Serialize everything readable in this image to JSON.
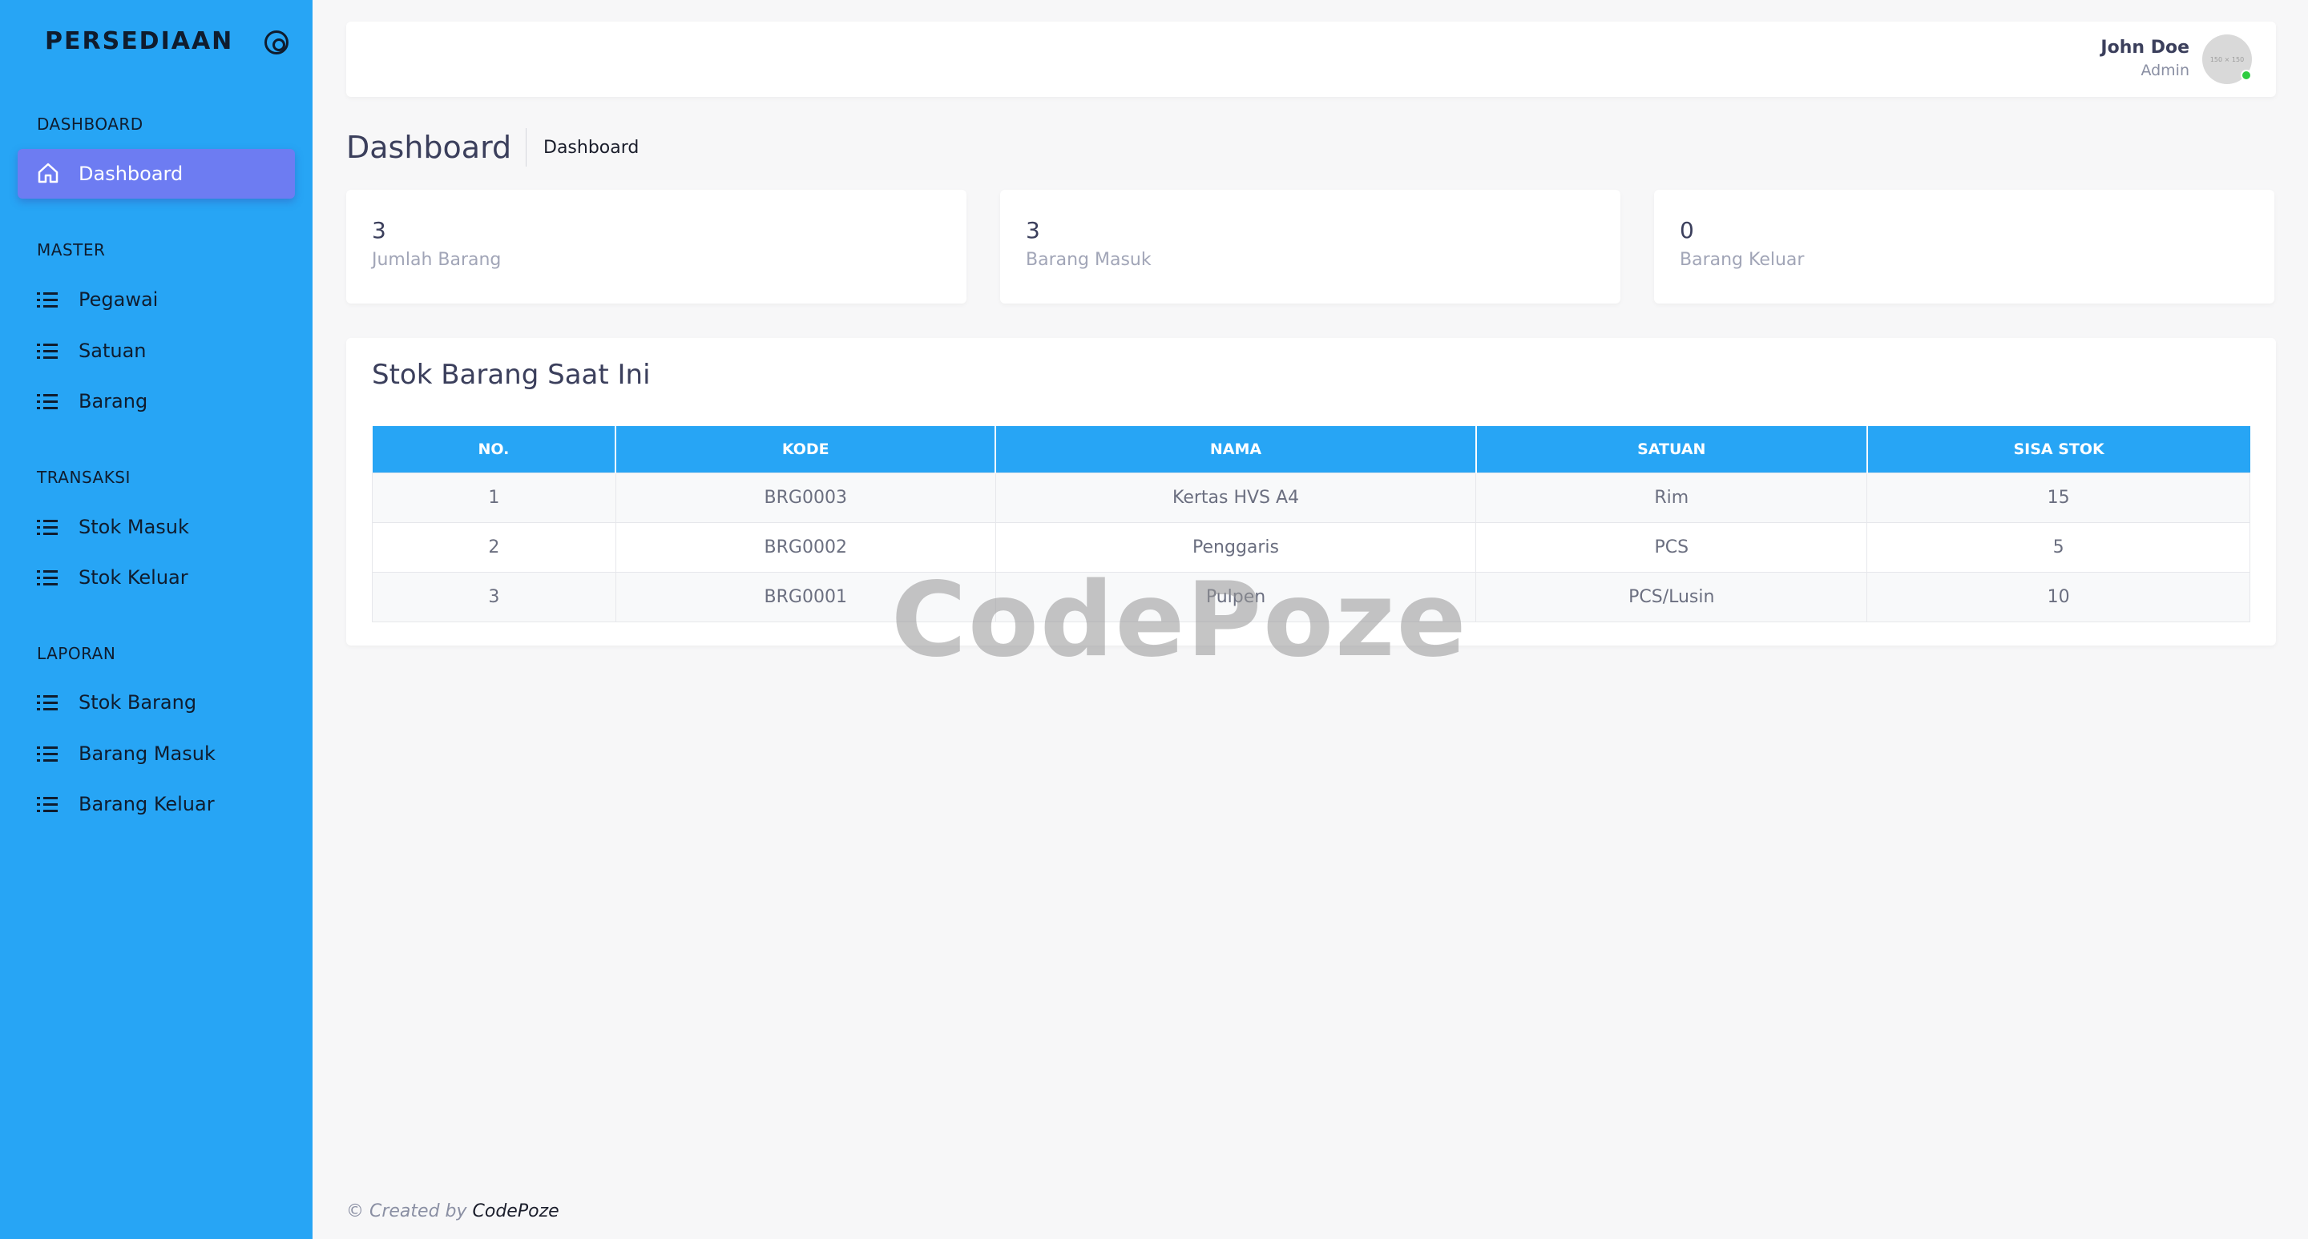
{
  "sidebar": {
    "brand": "PERSEDIAAN",
    "sections": [
      {
        "title": "DASHBOARD",
        "items": [
          {
            "label": "Dashboard",
            "icon": "home-icon",
            "active": true
          }
        ]
      },
      {
        "title": "MASTER",
        "items": [
          {
            "label": "Pegawai",
            "icon": "list-icon"
          },
          {
            "label": "Satuan",
            "icon": "list-icon"
          },
          {
            "label": "Barang",
            "icon": "list-icon"
          }
        ]
      },
      {
        "title": "TRANSAKSI",
        "items": [
          {
            "label": "Stok Masuk",
            "icon": "list-icon"
          },
          {
            "label": "Stok Keluar",
            "icon": "list-icon"
          }
        ]
      },
      {
        "title": "LAPORAN",
        "items": [
          {
            "label": "Stok Barang",
            "icon": "list-icon"
          },
          {
            "label": "Barang Masuk",
            "icon": "list-icon"
          },
          {
            "label": "Barang Keluar",
            "icon": "list-icon"
          }
        ]
      }
    ]
  },
  "header": {
    "user_name": "John Doe",
    "user_role": "Admin",
    "avatar_text": "150 × 150"
  },
  "page": {
    "title": "Dashboard",
    "breadcrumb": "Dashboard"
  },
  "stats": [
    {
      "value": "3",
      "label": "Jumlah Barang"
    },
    {
      "value": "3",
      "label": "Barang Masuk"
    },
    {
      "value": "0",
      "label": "Barang Keluar"
    }
  ],
  "stock_table": {
    "title": "Stok Barang Saat Ini",
    "columns": [
      "NO.",
      "KODE",
      "NAMA",
      "SATUAN",
      "SISA STOK"
    ],
    "rows": [
      [
        "1",
        "BRG0003",
        "Kertas HVS A4",
        "Rim",
        "15"
      ],
      [
        "2",
        "BRG0002",
        "Penggaris",
        "PCS",
        "5"
      ],
      [
        "3",
        "BRG0001",
        "Pulpen",
        "PCS/Lusin",
        "10"
      ]
    ]
  },
  "watermark": "CodePoze",
  "footer": {
    "prefix": "© Created by ",
    "brand": "CodePoze"
  },
  "colors": {
    "sidebar_bg": "#27a5f5",
    "active_item": "#6d7cf2",
    "table_header": "#27a5f5",
    "status_online": "#2ecc40"
  }
}
